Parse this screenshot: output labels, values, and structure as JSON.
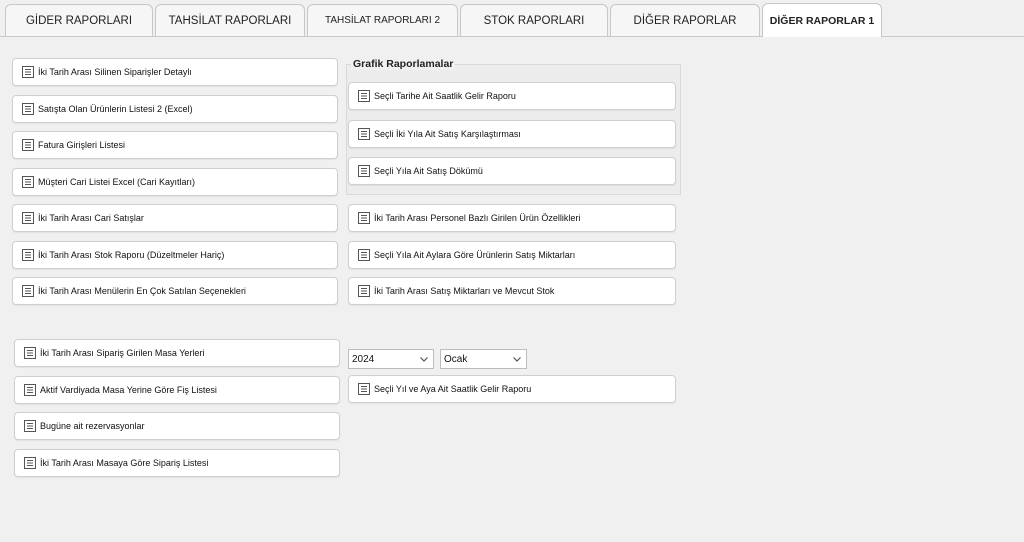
{
  "tabs": [
    {
      "label": "GİDER RAPORLARI"
    },
    {
      "label": "TAHSİLAT RAPORLARI"
    },
    {
      "label": "TAHSİLAT RAPORLARI 2"
    },
    {
      "label": "STOK RAPORLARI"
    },
    {
      "label": "DİĞER RAPORLAR"
    },
    {
      "label": "DİĞER RAPORLAR 1"
    }
  ],
  "active_tab": "DİĞER RAPORLAR 1",
  "left_reports": [
    {
      "label": "İki Tarih Arası Silinen Siparişler Detaylı"
    },
    {
      "label": "Satışta Olan Ürünlerin Listesi 2 (Excel)"
    },
    {
      "label": "Fatura Girişleri Listesi"
    },
    {
      "label": "Müşteri Cari Listei Excel (Cari Kayıtları)"
    },
    {
      "label": "İki Tarih Arası Cari Satışlar"
    },
    {
      "label": "İki Tarih Arası Stok Raporu (Düzeltmeler Hariç)"
    },
    {
      "label": "İki Tarih Arası Menülerin En Çok Satılan Seçenekleri"
    }
  ],
  "graphic_reports": {
    "title": "Grafik Raporlamalar",
    "items": [
      {
        "label": "Seçli Tarihe Ait Saatlik Gelir Raporu"
      },
      {
        "label": "Seçli İki Yıla Ait Satış Karşılaştırması"
      },
      {
        "label": "Seçli Yıla Ait Satış Dökümü"
      }
    ]
  },
  "right_reports": [
    {
      "label": "İki Tarih Arası Personel Bazlı Girilen Ürün Özellikleri"
    },
    {
      "label": "Seçli Yıla Ait Aylara Göre Ürünlerin Satış Miktarları"
    },
    {
      "label": "İki Tarih Arası Satış Miktarları ve Mevcut Stok"
    }
  ],
  "table_reports": [
    {
      "label": "İki Tarih Arası Sipariş Girilen Masa Yerleri"
    },
    {
      "label": "Aktif Vardiyada Masa Yerine Göre Fiş Listesi"
    },
    {
      "label": "Bugüne ait rezervasyonlar"
    },
    {
      "label": "İki Tarih Arası Masaya Göre Sipariş Listesi"
    }
  ],
  "filters": {
    "year": {
      "value": "2024"
    },
    "month": {
      "value": "Ocak"
    }
  },
  "hourly_report": {
    "label": "Seçli Yıl ve Aya Ait Saatlik Gelir Raporu"
  }
}
